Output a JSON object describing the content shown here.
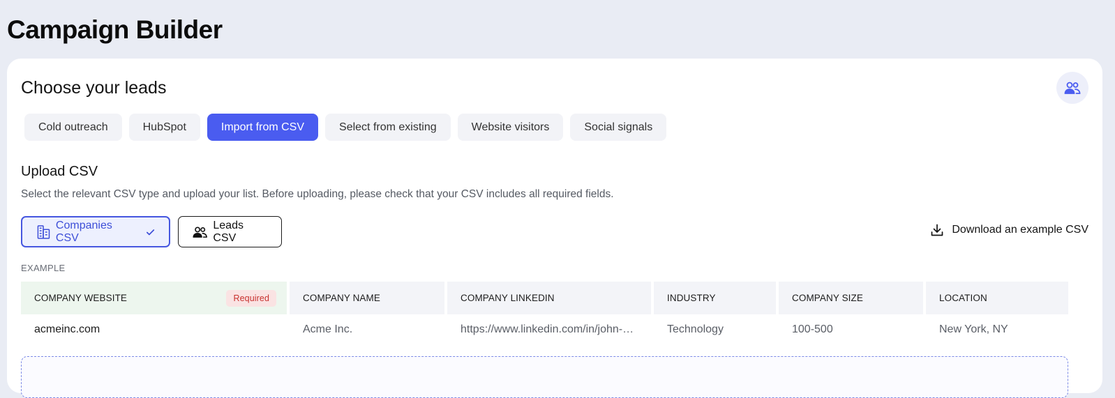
{
  "page": {
    "title": "Campaign Builder"
  },
  "card": {
    "title": "Choose your leads",
    "corner_icon": "users-icon"
  },
  "tabs": [
    {
      "label": "Cold outreach",
      "active": false
    },
    {
      "label": "HubSpot",
      "active": false
    },
    {
      "label": "Import from CSV",
      "active": true
    },
    {
      "label": "Select from existing",
      "active": false
    },
    {
      "label": "Website visitors",
      "active": false
    },
    {
      "label": "Social signals",
      "active": false
    }
  ],
  "upload": {
    "title": "Upload CSV",
    "description": "Select the relevant CSV type and upload your list. Before uploading, please check that your CSV includes all required fields.",
    "types": [
      {
        "label": "Companies CSV",
        "icon": "building-icon",
        "selected": true,
        "check_icon": "check-icon"
      },
      {
        "label": "Leads CSV",
        "icon": "users-icon",
        "selected": false
      }
    ],
    "download_label": "Download an example CSV",
    "download_icon": "download-icon"
  },
  "example": {
    "label": "EXAMPLE",
    "required_badge": "Required",
    "columns": [
      "COMPANY WEBSITE",
      "COMPANY NAME",
      "COMPANY LINKEDIN",
      "INDUSTRY",
      "COMPANY SIZE",
      "LOCATION"
    ],
    "row": [
      "acmeinc.com",
      "Acme Inc.",
      "https://www.linkedin.com/in/john-…",
      "Technology",
      "100-500",
      "New York, NY"
    ]
  },
  "colors": {
    "accent": "#4a5cf0",
    "required_bg": "#edf6ee",
    "badge_text": "#c8322f"
  }
}
